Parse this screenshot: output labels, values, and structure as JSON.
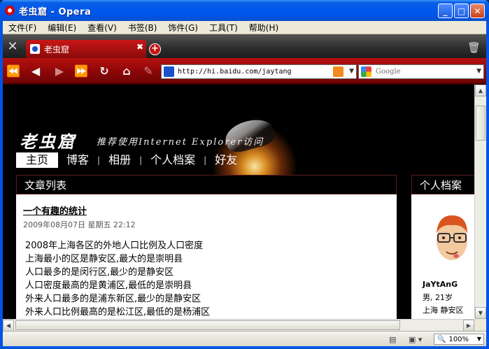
{
  "window": {
    "title": "老虫窟 - Opera"
  },
  "menu": [
    "文件(F)",
    "编辑(E)",
    "查看(V)",
    "书签(B)",
    "饰件(G)",
    "工具(T)",
    "帮助(H)"
  ],
  "tab": {
    "label": "老虫窟"
  },
  "address": {
    "url": "http://hi.baidu.com/jaytang"
  },
  "search": {
    "placeholder": "Google"
  },
  "site": {
    "title": "老虫窟",
    "subtitle": "推荐使用Internet Explorer访问",
    "nav": [
      "主页",
      "博客",
      "相册",
      "个人档案",
      "好友"
    ]
  },
  "articles": {
    "heading": "文章列表",
    "post_title": "一个有趣的统计",
    "post_date": "2009年08月07日 星期五 22:12",
    "lines": [
      "2008年上海各区的外地人口比例及人口密度",
      "上海最小的区是静安区,最大的是崇明县",
      "人口最多的是闵行区,最少的是静安区",
      "人口密度最高的是黄浦区,最低的是崇明县",
      "外来人口最多的是浦东新区,最少的是静安区",
      "外来人口比例最高的是松江区,最低的是杨浦区"
    ]
  },
  "profile": {
    "heading": "个人档案",
    "name": "JaYtAnG",
    "gender_age": "男, 21岁",
    "location": "上海 静安区"
  },
  "status": {
    "zoom": "100%"
  },
  "colors": {
    "opera_red": "#8c0707",
    "xp_blue": "#0054e3"
  }
}
